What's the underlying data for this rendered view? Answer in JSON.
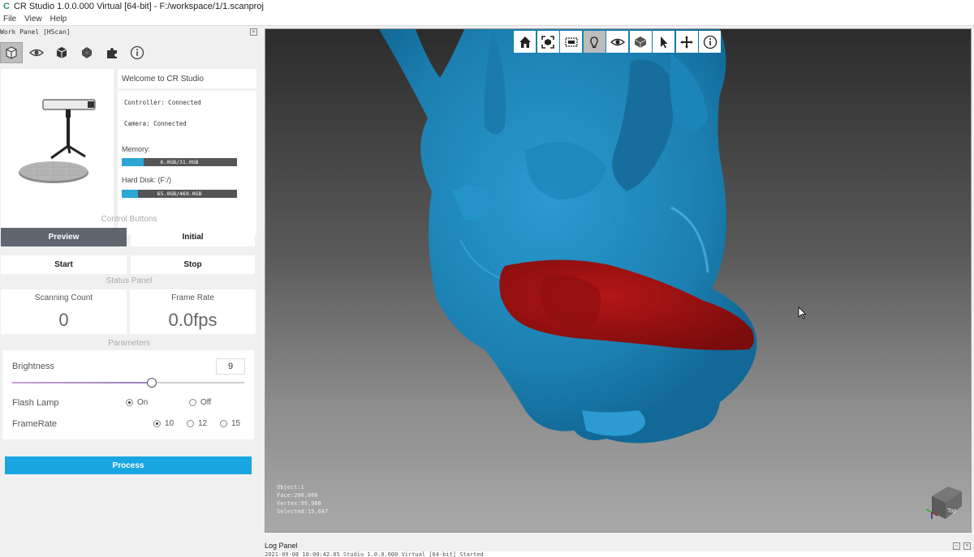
{
  "window": {
    "title": "CR Studio 1.0.0.000 Virtual [64-bit] - F:/workspace/1/1.scanproj",
    "logo": "C"
  },
  "menu": [
    "File",
    "View",
    "Help"
  ],
  "work_panel": {
    "title": "Work Panel [HScan]",
    "toolbar": [
      "scan-cube-icon",
      "eye-icon",
      "box-icon",
      "mesh-icon",
      "puzzle-icon",
      "info-icon"
    ],
    "welcome": "Welcome to CR Studio",
    "controller": "Controller: Connected",
    "camera": "Camera: Connected",
    "memory_label": "Memory:",
    "memory_text": "6.0GB/31.0GB",
    "memory_fraction": 0.19,
    "disk_label": "Hard Disk: (F:/)",
    "disk_text": "65.0GB/469.0GB",
    "disk_fraction": 0.14,
    "control_buttons_label": "Control Buttons",
    "preview": "Preview",
    "initial": "Initial",
    "start": "Start",
    "stop": "Stop",
    "status_panel_label": "Status Panel",
    "scanning_count_label": "Scanning Count",
    "scanning_count": "0",
    "frame_rate_label": "Frame Rate",
    "frame_rate": "0.0fps",
    "parameters_label": "Parameters",
    "brightness_label": "Brightness",
    "brightness_value": "9",
    "brightness_fraction": 0.6,
    "flash_label": "Flash Lamp",
    "flash_on": "On",
    "flash_off": "Off",
    "framerate_label": "FrameRate",
    "fr_10": "10",
    "fr_12": "12",
    "fr_15": "15",
    "process": "Process"
  },
  "viewport": {
    "toolbar": [
      "home-icon",
      "fit-view-icon",
      "select-box-icon",
      "light-icon",
      "eye-icon",
      "layers-icon",
      "pointer-icon",
      "move-icon",
      "info-icon"
    ],
    "object": "Object:1",
    "face": "Face:200,000",
    "vertex": "Vertex:99,988",
    "selected": "Selected:15,647",
    "axes_label": "Top",
    "colors": {
      "model": "#1f86b8",
      "selection": "#a01212"
    }
  },
  "log_panel": {
    "title": "Log Panel",
    "line": "2021-09-08 10:00:42.05 Studio 1.0.0.000 Virtual [64-bit] Started"
  }
}
